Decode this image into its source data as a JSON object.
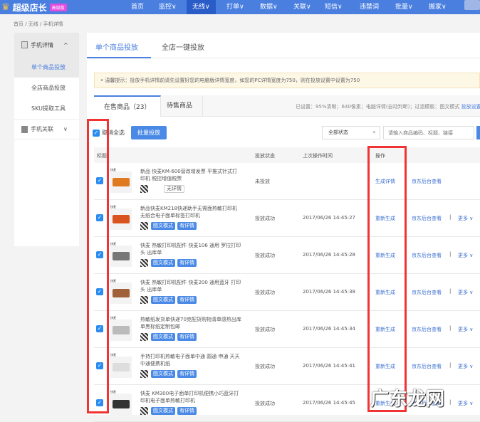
{
  "app": {
    "logo": "超级店长",
    "badge": "高级版"
  },
  "nav": [
    "首页",
    "监控∨",
    "无线∨",
    "打单∨",
    "数据∨",
    "关联∨",
    "短信∨",
    "违禁词",
    "批量∨",
    "搬家∨"
  ],
  "nav_active": 2,
  "breadcrumb": "首页 / 无线 / 手机详情",
  "sidebar": {
    "group1": "手机详情",
    "group1_chevron": "^",
    "items": [
      "单个商品投放",
      "全店商品投放",
      "SKU提取工具"
    ],
    "group2": "手机关联",
    "group2_chevron": "∨"
  },
  "top_tabs": [
    "单个商品投放",
    "全店一键投放"
  ],
  "tip": "• 温馨提示：投放手机详情前请先设置好您的电脑版详情宽度，如您的PC详情宽度为750，则在投放设置中设置为750",
  "sub_tabs": [
    "在售商品（23）",
    "待售商品"
  ],
  "settings_info": "已设置：95%清晰；640像素；电脑详情(自动判断)；过滤模板：图文模式",
  "settings_link": "投放设置",
  "toolbar": {
    "select_all": "取消全选",
    "batch": "批量投放",
    "status_select": "全部状态",
    "search_placeholder": "请输入商品编码、标题、链接"
  },
  "columns": {
    "title": "标题",
    "status": "投放状态",
    "time": "上次操作时间",
    "op": "操作"
  },
  "more_label": "更多 ∨",
  "rows": [
    {
      "brand": "快麦",
      "title": "新品 快麦KM-600营改增发票 平推式针式打印机 税控增值税票",
      "tags": [
        "无详情"
      ],
      "plain": true,
      "status": "未投放",
      "time": "",
      "op": "生成详情",
      "jd": "京东后台查看",
      "more": false,
      "color": "#e07a20"
    },
    {
      "brand": "快麦",
      "title": "新品快麦KM218快递助手无需面热敏打印机无纸合电子面单标签打印机",
      "tags": [
        "图文模式",
        "有详情"
      ],
      "status": "投放成功",
      "time": "2017/06/26 14:45:27",
      "op": "重新生成",
      "jd": "京东后台查看",
      "more": true,
      "color": "#d9541e"
    },
    {
      "brand": "快麦",
      "title": "快麦 热敏打印机配件 快麦106 通用 罗拉打印头 出库单",
      "tags": [
        "图文模式",
        "有详情"
      ],
      "status": "投放成功",
      "time": "2017/06/26 14:45:28",
      "op": "重新生成",
      "jd": "京东后台查看",
      "more": true,
      "color": "#777"
    },
    {
      "brand": "快麦",
      "title": "快麦 热敏打印机配件 快麦200 通用蓝牙 打印头 出库单",
      "tags": [
        "图文模式",
        "有详情"
      ],
      "status": "投放成功",
      "time": "2017/06/26 14:45:38",
      "op": "重新生成",
      "jd": "京东后台查看",
      "more": true,
      "color": "#a0603a"
    },
    {
      "brand": "快麦",
      "title": "热敏纸发货单快递70克配货购物清单感热出库单黑标纸定制包邮",
      "tags": [
        "图文模式",
        "有详情"
      ],
      "status": "投放成功",
      "time": "2017/06/26 14:45:34",
      "op": "重新生成",
      "jd": "京东后台查看",
      "more": true,
      "color": "#bbb"
    },
    {
      "brand": "快麦",
      "title": "手持打印机热敏电子面单中通  圆通 申通 天天 中通便携机纸",
      "tags": [
        "图文模式",
        "有详情"
      ],
      "status": "投放成功",
      "time": "2017/06/26 14:45:41",
      "op": "重新生成",
      "jd": "京东后台查看",
      "more": true,
      "color": "#ddd"
    },
    {
      "brand": "快麦",
      "title": "快麦 KM300电子面单打印机便携小巧蓝牙打印机电子面单热敏打印机",
      "tags": [
        "图文模式",
        "有详情"
      ],
      "status": "投放成功",
      "time": "2017/06/26 14:45:45",
      "op": "重新生成",
      "jd": "京东后台查看",
      "more": true,
      "color": "#333"
    }
  ],
  "watermark": "广东龙网",
  "colors": {
    "nav": "#4a7fe0",
    "accent": "#4a8ae6",
    "highlight": "#f03434"
  }
}
